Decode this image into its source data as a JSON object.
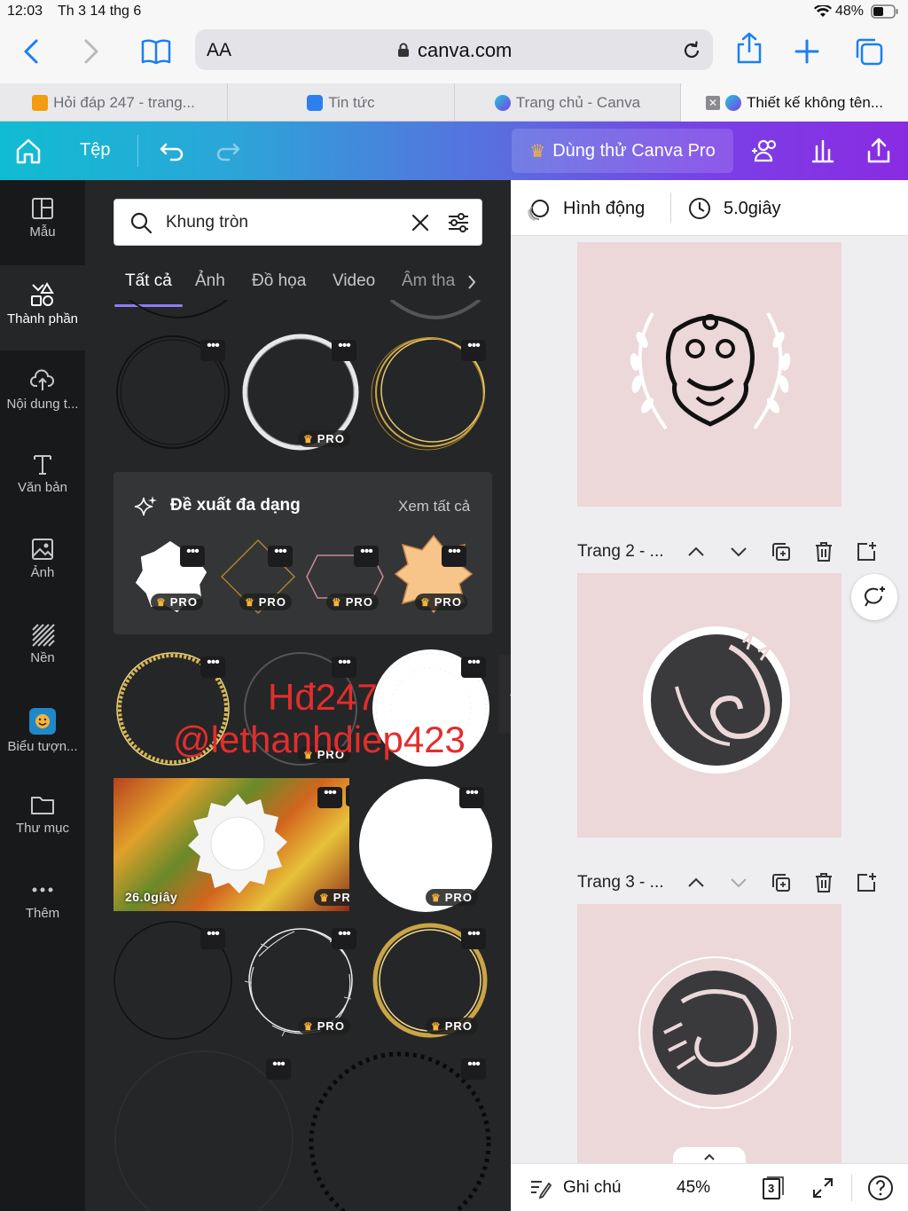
{
  "status": {
    "time": "12:03",
    "date": "Th 3 14 thg 6",
    "battery": "48%"
  },
  "browser": {
    "text_size": "AA",
    "url": "canva.com"
  },
  "tabs": [
    {
      "label": "Hỏi đáp 247 - trang...",
      "active": false
    },
    {
      "label": "Tin tức",
      "active": false
    },
    {
      "label": "Trang chủ - Canva",
      "active": false
    },
    {
      "label": "Thiết kế không tên...",
      "active": true
    }
  ],
  "header": {
    "file": "Tệp",
    "pro": "Dùng thử Canva Pro"
  },
  "rail": [
    {
      "label": "Mẫu",
      "icon": "templates-icon"
    },
    {
      "label": "Thành phần",
      "icon": "elements-icon"
    },
    {
      "label": "Nội dung t...",
      "icon": "upload-icon"
    },
    {
      "label": "Văn bản",
      "icon": "text-icon"
    },
    {
      "label": "Ảnh",
      "icon": "photo-icon"
    },
    {
      "label": "Nền",
      "icon": "background-icon"
    },
    {
      "label": "Biểu tượn...",
      "icon": "sticker-icon"
    },
    {
      "label": "Thư mục",
      "icon": "folder-icon"
    },
    {
      "label": "Thêm",
      "icon": "more-icon"
    }
  ],
  "search": {
    "value": "Khung tròn"
  },
  "categories": [
    "Tất cả",
    "Ảnh",
    "Đồ họa",
    "Video",
    "Âm tha"
  ],
  "suggest": {
    "title": "Đề xuất đa dạng",
    "see_all": "Xem tất cả"
  },
  "pro_label": "PRO",
  "video_duration": "26.0giây",
  "right": {
    "animate": "Hình động",
    "duration": "5.0giây",
    "page2": "Trang 2 - ...",
    "page3": "Trang 3 - ..."
  },
  "footer": {
    "notes": "Ghi chú",
    "zoom": "45%",
    "pages": "3"
  },
  "watermark": {
    "line1": "Hđ247",
    "line2": "@lethanhdiep423"
  }
}
